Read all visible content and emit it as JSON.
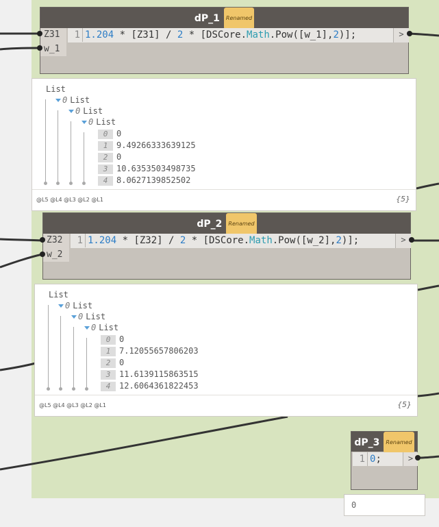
{
  "nodes": [
    {
      "title": "dP_1",
      "badge": "Renamed",
      "inputs": [
        "Z31",
        "w_1"
      ],
      "code": {
        "line": "1",
        "tokens": [
          {
            "t": "1.204",
            "c": "num"
          },
          {
            "t": " * [Z31] / ",
            "c": ""
          },
          {
            "t": "2",
            "c": "num"
          },
          {
            "t": " * [DSCore.",
            "c": ""
          },
          {
            "t": "Math",
            "c": "cls"
          },
          {
            "t": ".Pow([w_1],",
            "c": ""
          },
          {
            "t": "2",
            "c": "num"
          },
          {
            "t": ")];",
            "c": ""
          }
        ]
      },
      "output_label": ">",
      "preview": {
        "root": "List",
        "levels": [
          {
            "index": "0",
            "label": "List"
          },
          {
            "index": "0",
            "label": "List"
          },
          {
            "index": "0",
            "label": "List"
          }
        ],
        "items": [
          {
            "index": "0",
            "value": "0"
          },
          {
            "index": "1",
            "value": "9.49266333639125"
          },
          {
            "index": "2",
            "value": "0"
          },
          {
            "index": "3",
            "value": "10.6353503498735"
          },
          {
            "index": "4",
            "value": "8.0627139852502"
          }
        ],
        "level_labels": "@L5 @L4 @L3 @L2 @L1",
        "count": "{5}"
      }
    },
    {
      "title": "dP_2",
      "badge": "Renamed",
      "inputs": [
        "Z32",
        "w_2"
      ],
      "code": {
        "line": "1",
        "tokens": [
          {
            "t": "1.204",
            "c": "num"
          },
          {
            "t": " * [Z32] / ",
            "c": ""
          },
          {
            "t": "2",
            "c": "num"
          },
          {
            "t": " * [DSCore.",
            "c": ""
          },
          {
            "t": "Math",
            "c": "cls"
          },
          {
            "t": ".Pow([w_2],",
            "c": ""
          },
          {
            "t": "2",
            "c": "num"
          },
          {
            "t": ")];",
            "c": ""
          }
        ]
      },
      "output_label": ">",
      "preview": {
        "root": "List",
        "levels": [
          {
            "index": "0",
            "label": "List"
          },
          {
            "index": "0",
            "label": "List"
          },
          {
            "index": "0",
            "label": "List"
          }
        ],
        "items": [
          {
            "index": "0",
            "value": "0"
          },
          {
            "index": "1",
            "value": "7.12055657806203"
          },
          {
            "index": "2",
            "value": "0"
          },
          {
            "index": "3",
            "value": "11.6139115863515"
          },
          {
            "index": "4",
            "value": "12.6064361822453"
          }
        ],
        "level_labels": "@L5 @L4 @L3 @L2 @L1",
        "count": "{5}"
      }
    },
    {
      "title": "dP_3",
      "badge": "Renamed",
      "code": {
        "line": "1",
        "tokens": [
          {
            "t": "0",
            "c": "num"
          },
          {
            "t": ";",
            "c": ""
          }
        ]
      },
      "output_label": ">",
      "preview_value": "0"
    }
  ],
  "colors": {
    "canvas": "#f0f0f0",
    "group": "#d8e4bf",
    "node_header": "#5c5753",
    "node_body": "#c7c2bb",
    "badge": "#f0c66a",
    "number": "#2d7dc6",
    "class_name": "#2d9cb0",
    "wire": "#333333"
  }
}
